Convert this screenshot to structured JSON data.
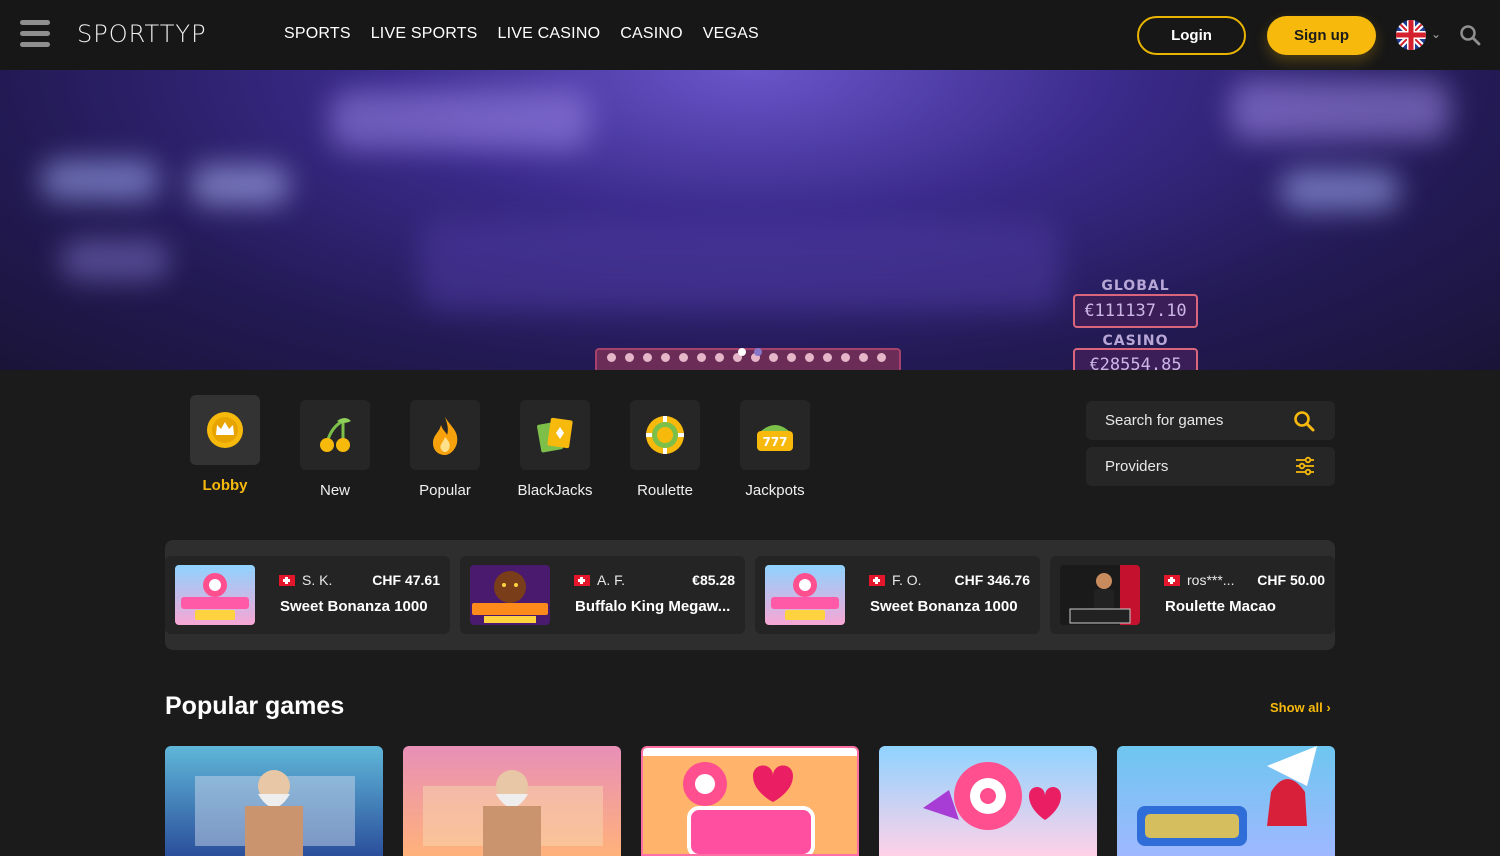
{
  "header": {
    "logo": "SPORTTYP",
    "nav": [
      "SPORTS",
      "LIVE SPORTS",
      "LIVE CASINO",
      "CASINO",
      "VEGAS"
    ],
    "login_label": "Login",
    "signup_label": "Sign up"
  },
  "hero": {
    "jackpots": [
      {
        "label": "GLOBAL",
        "value": "€111137.10"
      },
      {
        "label": "CASINO",
        "value": "€28554.85"
      }
    ],
    "slides_count": 2,
    "active_slide": 1
  },
  "categories": [
    {
      "label": "Lobby",
      "icon": "crown-icon",
      "active": true
    },
    {
      "label": "New",
      "icon": "cherries-icon",
      "active": false
    },
    {
      "label": "Popular",
      "icon": "flame-icon",
      "active": false
    },
    {
      "label": "BlackJacks",
      "icon": "cards-icon",
      "active": false
    },
    {
      "label": "Roulette",
      "icon": "roulette-chip-icon",
      "active": false
    },
    {
      "label": "Jackpots",
      "icon": "slot-777-icon",
      "active": false
    }
  ],
  "search": {
    "label": "Search for games"
  },
  "providers": {
    "label": "Providers"
  },
  "recent_wins": [
    {
      "player": "S. K.",
      "amount": "CHF 47.61",
      "game": "Sweet Bonanza 1000",
      "country": "Switzerland"
    },
    {
      "player": "A. F.",
      "amount": "€85.28",
      "game": "Buffalo King Megaw...",
      "country": "Switzerland"
    },
    {
      "player": "F. O.",
      "amount": "CHF 346.76",
      "game": "Sweet Bonanza 1000",
      "country": "Switzerland"
    },
    {
      "player": "ros***...",
      "amount": "CHF 50.00",
      "game": "Roulette Macao",
      "country": "Switzerland"
    }
  ],
  "popular": {
    "title": "Popular games",
    "show_all": "Show all",
    "tiles": [
      "gates-of-olympus",
      "gates-of-olympus-1000",
      "sweet-bonanza",
      "sweet-bonanza-1000",
      "starlight-princess"
    ]
  },
  "colors": {
    "accent": "#f7b90c",
    "background": "#1b1b1b",
    "panel": "#262626"
  }
}
